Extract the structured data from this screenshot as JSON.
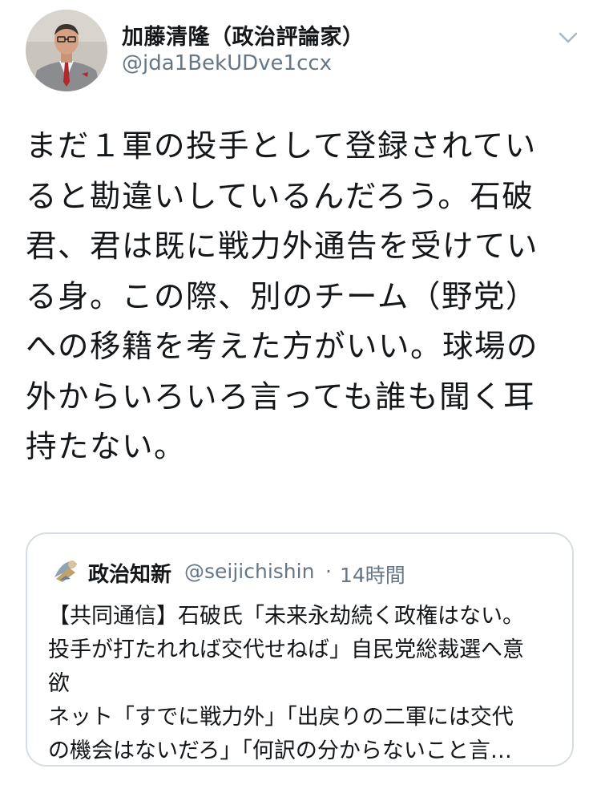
{
  "tweet": {
    "author": {
      "display_name": "加藤清隆（政治評論家）",
      "handle": "@jda1BekUDve1ccx",
      "avatar_icon": "profile-photo"
    },
    "menu_icon": "chevron-down-icon",
    "text": "まだ１軍の投手として登録されてい\nると勘違いしているんだろう。石破\n君、君は既に戦力外通告を受けてい\nる身。この際、別のチーム（野党）\nへの移籍を考えた方がいい。球場の\n外からいろいろ言っても誰も聞く耳\n持たない。",
    "quoted": {
      "display_name": "政治知新",
      "handle": "@seijichishin",
      "separator": "·",
      "time": "14時間",
      "text": "【共同通信】石破氏「未来永劫続く政権はない。\n投手が打たれれば交代せねば」自民党総裁選へ意\n欲\nネット「すでに戦力外」「出戻りの二軍には交代\nの機会はないだろ」「何訳の分からないこと言…"
    }
  },
  "colors": {
    "text_primary": "#14171a",
    "text_secondary": "#657786",
    "border": "#d6dde4",
    "caret": "#aab8c2"
  }
}
